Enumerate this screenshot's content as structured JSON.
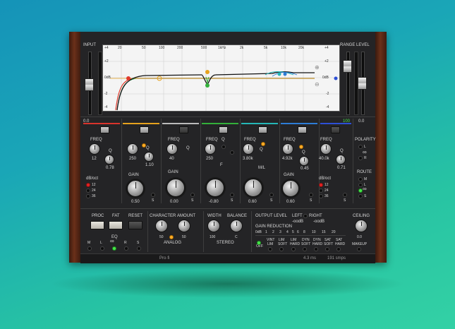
{
  "input": {
    "label": "INPUT",
    "value": "0.0",
    "scale": [
      "+4",
      "+2",
      "0dB",
      "-2",
      "-4"
    ]
  },
  "output": {
    "range_label": "RANGE",
    "level_label": "LEVEL",
    "range_value": "100",
    "level_value": "0.0"
  },
  "graph": {
    "freq_ticks": [
      "20",
      "50",
      "100",
      "200",
      "500",
      "1kHz",
      "2k",
      "5k",
      "10k",
      "20k"
    ],
    "db_left": [
      "+4",
      "+2",
      "0dB",
      "-2",
      "-4"
    ],
    "db_right": [
      "+4",
      "+2",
      "0dB",
      "-2",
      "-4"
    ]
  },
  "bands": [
    {
      "freq_label": "FREQ",
      "freq_value": "12",
      "q_label": "Q",
      "q_value": "0.78",
      "slope_label": "dB/oct",
      "slopes": [
        "12",
        "24",
        "36"
      ],
      "gain_label": "",
      "gain_value": "",
      "color": "#d8342c"
    },
    {
      "freq_value": "250",
      "q_label": "Q",
      "q_value": "1.10",
      "gain_label": "GAIN",
      "gain_value": "0.50",
      "s": "S",
      "color": "#e6a21e"
    },
    {
      "freq_label": "FREQ",
      "freq_value": "40",
      "q_label": "Q",
      "gain_label": "GAIN",
      "gain_value": "0.00",
      "s": "S",
      "color": "#c8c8c8"
    },
    {
      "freq_label": "FREQ",
      "freq_value": "250",
      "q_label": "Q",
      "fa_label": "F",
      "gain_value": "-0.80",
      "s": "S",
      "color": "#33b03a"
    },
    {
      "freq_label": "FREQ",
      "freq_value": "3.80k",
      "q_label": "Q",
      "ms_label": "M/L",
      "gain_value": "0.60",
      "s": "S",
      "color": "#25b7b7"
    },
    {
      "freq_label": "FREQ",
      "freq_value": "4.92k",
      "q_label": "Q",
      "q_value": "0.45",
      "gain_label": "GAIN",
      "gain_value": "0.60",
      "s": "S",
      "color": "#2d7cd6"
    },
    {
      "freq_label": "FREQ",
      "freq_value": "40.0k",
      "q_label": "Q",
      "q_value": "0.71",
      "slope_label": "dB/oct",
      "slopes": [
        "12",
        "24",
        "36"
      ],
      "s": "S",
      "color": "#2d4fd6"
    }
  ],
  "polarity": {
    "label": "POLARITY",
    "items": [
      "L",
      "R"
    ]
  },
  "route": {
    "label": "ROUTE",
    "items": [
      "M",
      "L",
      "S"
    ]
  },
  "proc": {
    "proc_label": "PROC",
    "fat_label": "FAT",
    "reset_label": "RESET",
    "eq_label": "EQ",
    "eq_items": [
      "M",
      "L",
      "R",
      "S"
    ]
  },
  "character": {
    "char_label": "CHARACTER",
    "amount_label": "AMOUNT",
    "char_value": "50",
    "amount_value": "50",
    "section": "ANALOG"
  },
  "stereo": {
    "width_label": "WIDTH",
    "balance_label": "BALANCE",
    "width_value": "100",
    "balance_value": "C",
    "section": "STEREO"
  },
  "output_section": {
    "level_label": "OUTPUT LEVEL",
    "left_label": "LEFT",
    "right_label": "RIGHT",
    "left_value": "-oodB",
    "right_value": "-oodB",
    "gr_label": "GAIN REDUCTION",
    "gr_scale": [
      "0dB",
      "1",
      "2",
      "3",
      "4",
      "5",
      "6",
      "8",
      "10",
      "15",
      "20"
    ],
    "ceiling_label": "CEILING",
    "ceiling_value": "0.0",
    "modes": [
      [
        "OFF"
      ],
      [
        "VINT",
        "LIM"
      ],
      [
        "LIM",
        "SOFT"
      ],
      [
        "LIM",
        "HARD"
      ],
      [
        "DYN",
        "SOFT"
      ],
      [
        "DYN",
        "HARD"
      ],
      [
        "SAT",
        "SOFT"
      ],
      [
        "SAT",
        "HARD"
      ],
      [
        "MAKEUP"
      ]
    ]
  },
  "status": {
    "title": "Pro·fi",
    "latency": "4.3 ms",
    "samples": "191 smps"
  }
}
